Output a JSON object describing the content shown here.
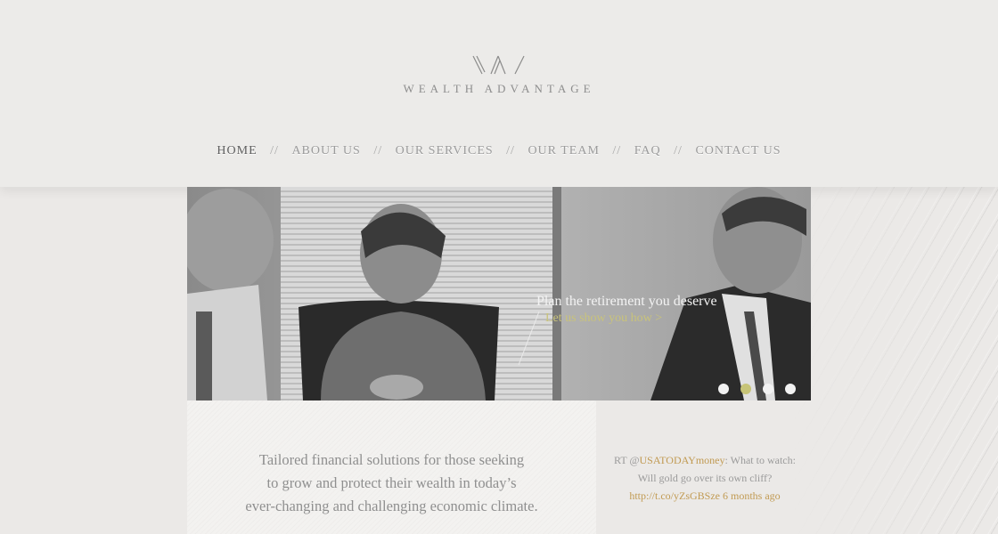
{
  "brand": {
    "name": "WEALTH ADVANTAGE"
  },
  "nav": {
    "items": [
      {
        "label": "HOME",
        "active": true
      },
      {
        "label": "ABOUT US"
      },
      {
        "label": "OUR SERVICES"
      },
      {
        "label": "OUR TEAM"
      },
      {
        "label": "FAQ"
      },
      {
        "label": "CONTACT US"
      }
    ],
    "separator": "//"
  },
  "hero": {
    "heading": "Plan the retirement you deserve",
    "link": "Let us show you how >",
    "slides_total": 4,
    "active_slide": 2
  },
  "main": {
    "tagline_lines": [
      "Tailored financial solutions for those seeking",
      "to grow and protect their wealth in today’s",
      "ever-changing and challenging economic climate."
    ]
  },
  "tweet": {
    "prefix": "RT @",
    "handle": "USATODAYmoney",
    "text": ": What to watch: Will gold go over its own cliff?",
    "link": "http://t.co/yZsGBSze",
    "time": "6 months ago"
  },
  "colors": {
    "background": "#ebe9e7",
    "accent_gold": "#c19a52",
    "slider_active": "#c7c477",
    "nav_text": "#9b9b9b"
  }
}
